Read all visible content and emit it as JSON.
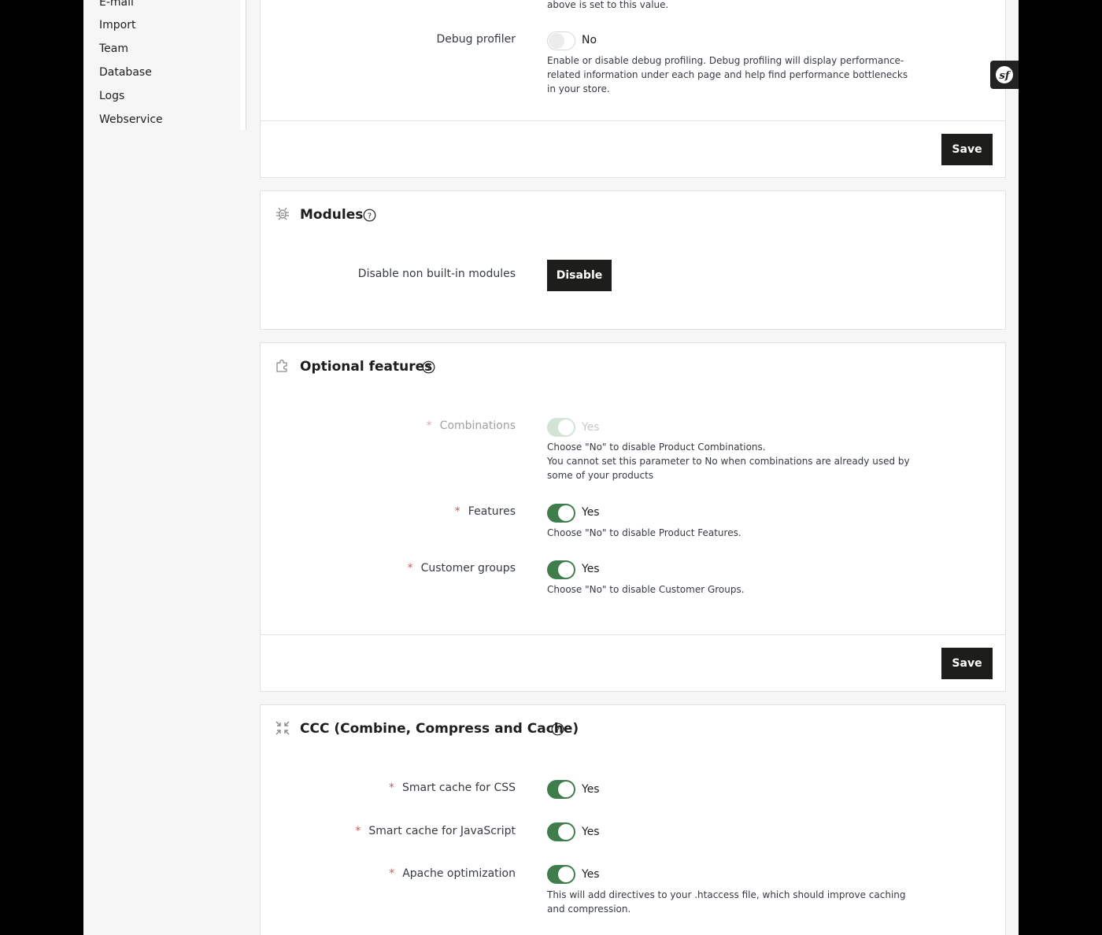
{
  "sidebar": {
    "items": [
      {
        "label": "E-mail"
      },
      {
        "label": "Import"
      },
      {
        "label": "Team"
      },
      {
        "label": "Database"
      },
      {
        "label": "Logs"
      },
      {
        "label": "Webservice"
      }
    ]
  },
  "debug": {
    "top_help": "above is set to this value.",
    "profiler_label": "Debug profiler",
    "profiler_value": "No",
    "profiler_help": "Enable or disable debug profiling. Debug profiling will display performance-related information under each page and help find performance bottlenecks in your store.",
    "save_label": "Save"
  },
  "modules": {
    "title": "Modules",
    "disable_label": "Disable non built-in modules",
    "disable_button": "Disable"
  },
  "optional_features": {
    "title": "Optional features",
    "combinations_label": "Combinations",
    "combinations_value": "Yes",
    "combinations_help_1": "Choose \"No\" to disable Product Combinations.",
    "combinations_help_2": "You cannot set this parameter to No when combinations are already used by some of your products",
    "features_label": "Features",
    "features_value": "Yes",
    "features_help": "Choose \"No\" to disable Product Features.",
    "customer_groups_label": "Customer groups",
    "customer_groups_value": "Yes",
    "customer_groups_help": "Choose \"No\" to disable Customer Groups.",
    "save_label": "Save"
  },
  "ccc": {
    "title": "CCC (Combine, Compress and Cache)",
    "css_label": "Smart cache for CSS",
    "css_value": "Yes",
    "js_label": "Smart cache for JavaScript",
    "js_value": "Yes",
    "apache_label": "Apache optimization",
    "apache_value": "Yes",
    "apache_help": "This will add directives to your .htaccess file, which should improve caching and compression."
  },
  "colors": {
    "accent_green": "#3f7d4d",
    "required_red": "#c05c67",
    "button_dark": "#1d1d1b"
  }
}
